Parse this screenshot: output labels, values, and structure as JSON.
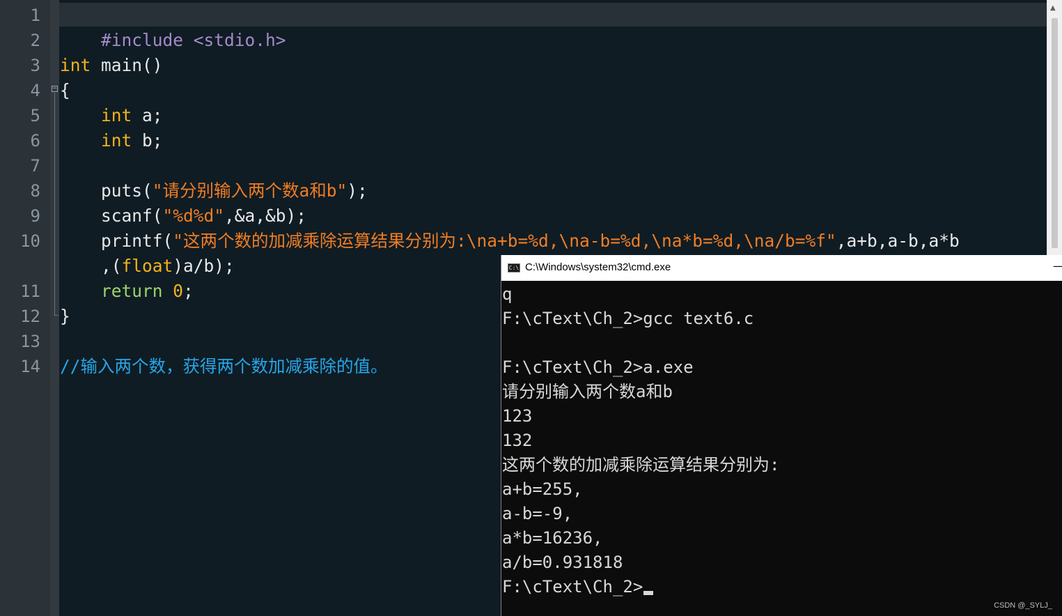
{
  "editor": {
    "line_numbers": [
      "1",
      "2",
      "3",
      "4",
      "5",
      "6",
      "7",
      "8",
      "9",
      "10",
      "11",
      "12",
      "13",
      "14"
    ],
    "fold_marker": "−",
    "code": {
      "l1_include": "#include <stdio.h>",
      "l3_kw": "int",
      "l3_rest": " main()",
      "l4": "{",
      "l5_kw": "int",
      "l5_rest": " a;",
      "l6_kw": "int",
      "l6_rest": " b;",
      "l8_fn": "puts(",
      "l8_str": "\"请分别输入两个数a和b\"",
      "l8_end": ");",
      "l9_fn": "scanf(",
      "l9_str": "\"%d%d\"",
      "l9_end": ",&a,&b);",
      "l10_fn": "printf(",
      "l10_str": "\"这两个数的加减乘除运算结果分别为:\\na+b=%d,\\na-b=%d,\\na*b=%d,\\na/b=%f\"",
      "l10_end": ",a+b,a-b,a*b",
      "l10b_start": ",(",
      "l10b_kw": "float",
      "l10b_end": ")a/b);",
      "l11_kw": "return",
      "l11_num": "0",
      "l11_end": ";",
      "l12": "}",
      "l14_comment": "//输入两个数，获得两个数加减乘除的值。"
    }
  },
  "cmd": {
    "title": "C:\\Windows\\system32\\cmd.exe",
    "icon_label": "C:\\",
    "minimize": "—",
    "lines": [
      "q",
      "F:\\cText\\Ch_2>gcc text6.c",
      "",
      "F:\\cText\\Ch_2>a.exe",
      "请分别输入两个数a和b",
      "123",
      "132",
      "这两个数的加减乘除运算结果分别为:",
      "a+b=255,",
      "a-b=-9,",
      "a*b=16236,",
      "a/b=0.931818",
      "F:\\cText\\Ch_2>"
    ]
  },
  "scrollbar": {
    "up_arrow": "▲"
  },
  "watermark": "CSDN @_SYLJ_",
  "colors": {
    "editor_bg": "#0f1c24",
    "gutter_bg": "#2b3238",
    "keyword": "#f3b31a",
    "string": "#f07d23",
    "preprocessor": "#a58ac8",
    "comment": "#27a5e6",
    "return": "#9dd36a",
    "console_bg": "#0c0c0c"
  }
}
